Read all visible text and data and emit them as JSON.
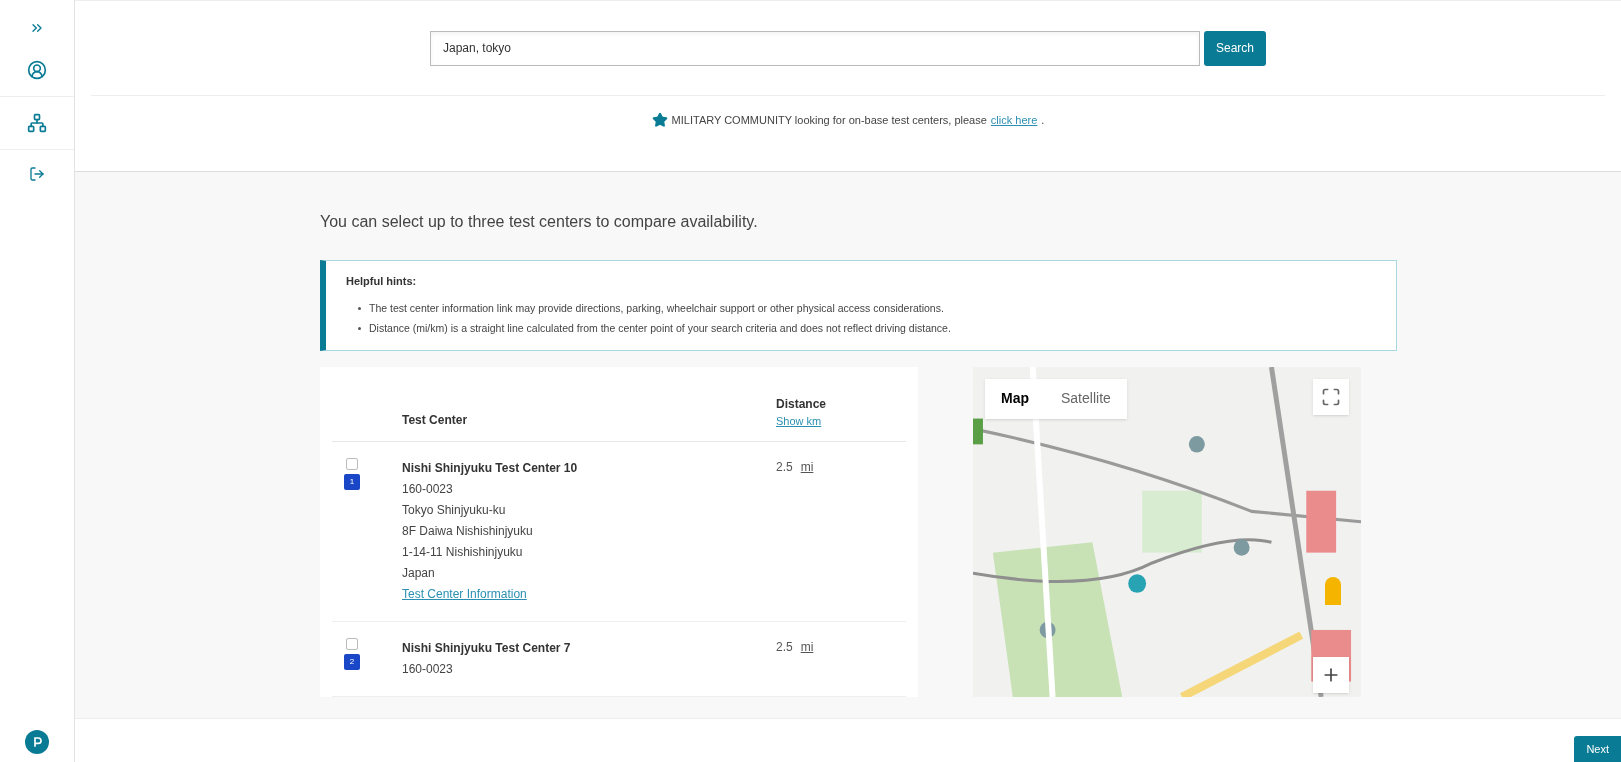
{
  "sidebar": {
    "items": [
      {
        "kind": "expand"
      },
      {
        "kind": "account"
      },
      {
        "kind": "sitemap"
      },
      {
        "kind": "logout"
      }
    ]
  },
  "search": {
    "value": "Japan, tokyo",
    "button": "Search"
  },
  "notice": {
    "text": "MILITARY COMMUNITY looking for on-base test centers, please",
    "link": "click here",
    "end": "."
  },
  "intro": "You can select up to three test centers to compare availability.",
  "hints": {
    "title": "Helpful hints:",
    "items": [
      "The test center information link may provide directions, parking, wheelchair support or other physical access considerations.",
      "Distance (mi/km) is a straight line calculated from the center point of your search criteria and does not reflect driving distance."
    ]
  },
  "table": {
    "columns": [
      "Test Center",
      "Distance"
    ],
    "unit_toggle": "Show km",
    "rows": [
      {
        "checked": false,
        "marker": "1",
        "name": "Nishi Shinjyuku Test Center 10",
        "lines": [
          "160-0023",
          "Tokyo Shinjyuku-ku",
          "8F Daiwa Nishishinjyuku",
          "1-14-11 Nishishinjyuku",
          "Japan"
        ],
        "link": "Test Center Information",
        "distance": "2.5",
        "unit": "mi"
      },
      {
        "checked": false,
        "marker": "2",
        "name": "Nishi Shinjyuku Test Center 7",
        "lines": [
          "160-0023"
        ],
        "distance": "2.5",
        "unit": "mi"
      }
    ]
  },
  "map": {
    "tabs": [
      {
        "label": "Map",
        "selected": true
      },
      {
        "label": "Satellite",
        "selected": false
      }
    ],
    "kind": "picture"
  },
  "footer": {
    "next": "Next"
  }
}
